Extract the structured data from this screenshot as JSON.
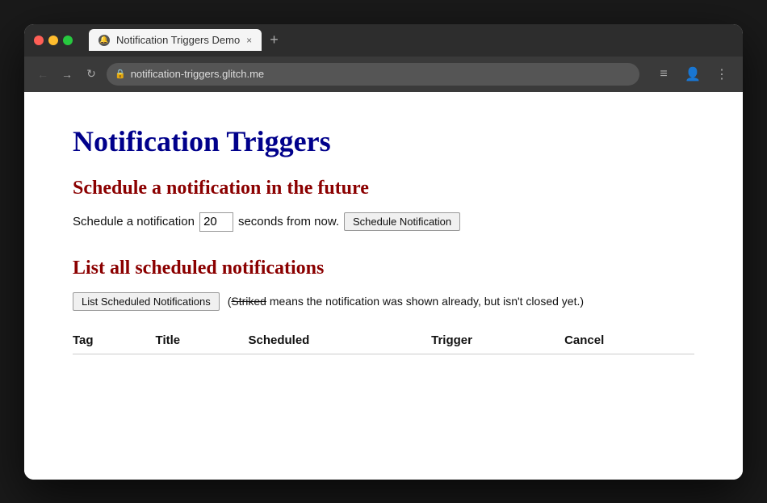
{
  "browser": {
    "traffic_lights": [
      "red",
      "yellow",
      "green"
    ],
    "tab": {
      "title": "Notification Triggers Demo",
      "close_label": "×",
      "new_tab_label": "+"
    },
    "address_bar": {
      "url": "notification-triggers.glitch.me",
      "lock_icon": "🔒"
    },
    "nav": {
      "back_label": "←",
      "forward_label": "→",
      "reload_label": "↻"
    },
    "toolbar": {
      "menu_icon": "≡",
      "profile_icon": "👤",
      "more_icon": "⋮"
    }
  },
  "page": {
    "title": "Notification Triggers",
    "sections": [
      {
        "id": "schedule",
        "heading": "Schedule a notification in the future",
        "schedule_label_before": "Schedule a notification",
        "schedule_input_value": "20",
        "schedule_label_after": "seconds from now.",
        "schedule_button_label": "Schedule Notification"
      },
      {
        "id": "list",
        "heading": "List all scheduled notifications",
        "list_button_label": "List Scheduled Notifications",
        "hint_prefix": "(",
        "hint_striked": "Striked",
        "hint_suffix": " means the notification was shown already, but isn't closed yet.)",
        "table_headers": [
          "Tag",
          "Title",
          "Scheduled",
          "Trigger",
          "Cancel"
        ],
        "table_rows": []
      }
    ]
  }
}
